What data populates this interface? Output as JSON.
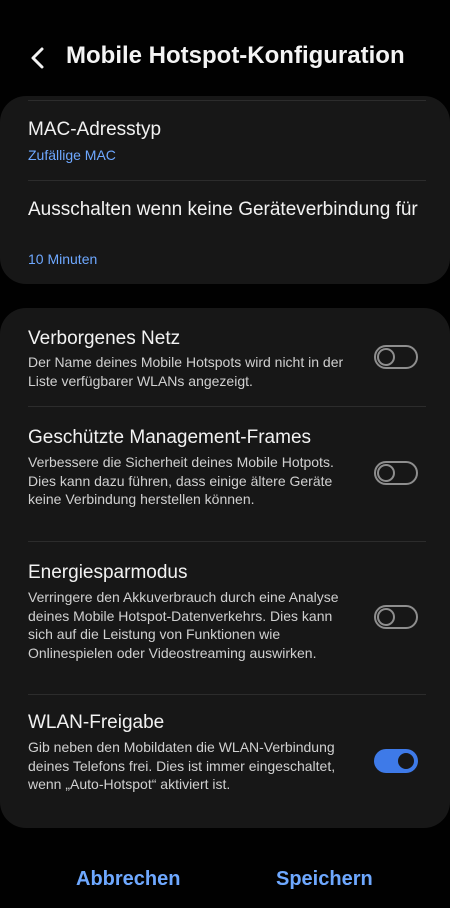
{
  "header": {
    "title": "Mobile Hotspot-Konfiguration",
    "back_icon": "chevron-left-icon"
  },
  "network_card": {
    "mac": {
      "title": "MAC-Adresstyp",
      "value": "Zufällige MAC"
    },
    "timeout": {
      "title": "Ausschalten wenn keine Geräteverbindung für",
      "value": "10 Minuten"
    }
  },
  "options_card": {
    "hidden_network": {
      "title": "Verborgenes Netz",
      "description": "Der Name deines Mobile Hotspots wird nicht in der Liste verfügbarer WLANs angezeigt.",
      "enabled": false
    },
    "pmf": {
      "title": "Geschützte Management-Frames",
      "description": "Verbessere die Sicherheit deines Mobile Hotpots. Dies kann dazu führen, dass einige ältere Geräte keine Verbindung herstellen können.",
      "enabled": false
    },
    "power_saving": {
      "title": "Energiesparmodus",
      "description": "Verringere den Akkuverbrauch durch eine Analyse deines Mobile Hotspot-Datenverkehrs. Dies kann sich auf die Leistung von Funktionen wie Onlinespielen oder Videostreaming auswirken.",
      "enabled": false
    },
    "wifi_sharing": {
      "title": "WLAN-Freigabe",
      "description": "Gib neben den Mobildaten die WLAN-Verbindung deines Telefons frei. Dies ist immer eingeschaltet, wenn „Auto-Hotspot“ aktiviert ist.",
      "enabled": true
    }
  },
  "footer": {
    "cancel_label": "Abbrechen",
    "save_label": "Speichern"
  },
  "colors": {
    "accent": "#6ea8ff",
    "toggle_on": "#3e7ae8",
    "card_bg": "#171717",
    "page_bg": "#010101"
  }
}
